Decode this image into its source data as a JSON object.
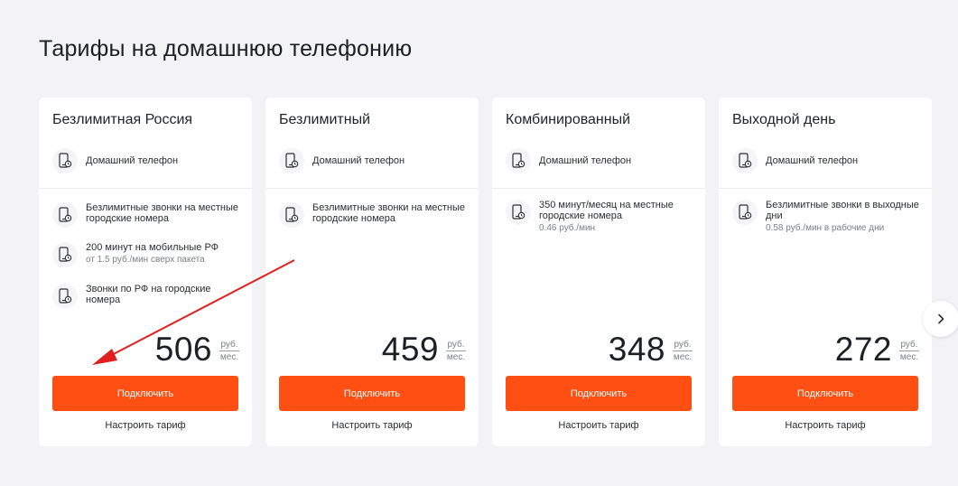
{
  "page": {
    "title": "Тарифы на домашнюю телефонию"
  },
  "colors": {
    "accent": "#ff4f12",
    "annotation": "#e02020",
    "background": "#f3f3f5"
  },
  "icons": {
    "feature": "phone-clock-icon",
    "next": "chevron-right-icon"
  },
  "cards": [
    {
      "name": "Безлимитная Россия",
      "head_feature": "Домашний телефон",
      "features": [
        {
          "title": "Безлимитные звонки на местные городские номера",
          "sub": ""
        },
        {
          "title": "200 минут на мобильные РФ",
          "sub": "от 1.5 руб./мин сверх пакета"
        },
        {
          "title": "Звонки по РФ на городские номера",
          "sub": ""
        }
      ],
      "price": "506",
      "unit_top": "руб.",
      "unit_bottom": "мес.",
      "button": "Подключить",
      "link": "Настроить тариф"
    },
    {
      "name": "Безлимитный",
      "head_feature": "Домашний телефон",
      "features": [
        {
          "title": "Безлимитные звонки на местные городские номера",
          "sub": ""
        }
      ],
      "price": "459",
      "unit_top": "руб.",
      "unit_bottom": "мес.",
      "button": "Подключить",
      "link": "Настроить тариф"
    },
    {
      "name": "Комбинированный",
      "head_feature": "Домашний телефон",
      "features": [
        {
          "title": "350 минут/месяц на местные городские номера",
          "sub": "0.46 руб./мин"
        }
      ],
      "price": "348",
      "unit_top": "руб.",
      "unit_bottom": "мес.",
      "button": "Подключить",
      "link": "Настроить тариф"
    },
    {
      "name": "Выходной день",
      "head_feature": "Домашний телефон",
      "features": [
        {
          "title": "Безлимитные звонки в выходные дни",
          "sub": "0.58 руб./мин в рабочие дни"
        }
      ],
      "price": "272",
      "unit_top": "руб.",
      "unit_bottom": "мес.",
      "button": "Подключить",
      "link": "Настроить тариф"
    }
  ]
}
